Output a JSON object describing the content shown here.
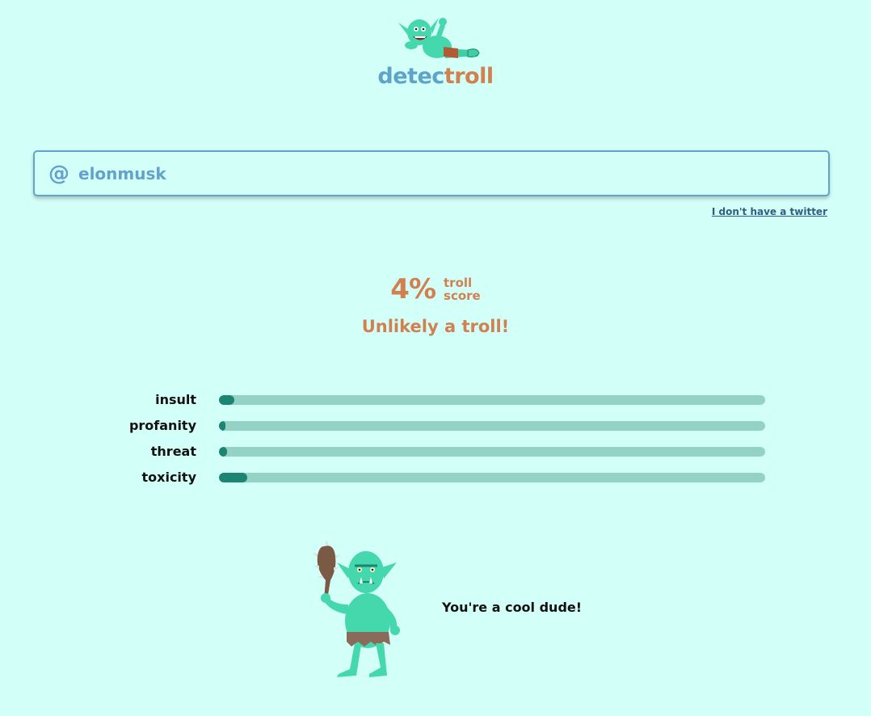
{
  "brand": {
    "part1": "detec",
    "part2": "troll",
    "colors": {
      "part1": "#5ea3c9",
      "part2": "#d1804f"
    },
    "mascot_icon": "lounging-troll-icon"
  },
  "search": {
    "prefix": "@",
    "value": "elonmusk"
  },
  "no_twitter_link": "I don't have a twitter",
  "score": {
    "percent_text": "4%",
    "label_line1": "troll",
    "label_line2": "score",
    "verdict": "Unlikely a troll!"
  },
  "metrics": [
    {
      "label": "insult",
      "value": 0.028
    },
    {
      "label": "profanity",
      "value": 0.012
    },
    {
      "label": "threat",
      "value": 0.015
    },
    {
      "label": "toxicity",
      "value": 0.052
    }
  ],
  "result": {
    "mascot_icon": "club-troll-icon",
    "message": "You're a cool dude!"
  },
  "colors": {
    "background": "#d3fff9",
    "accent_blue": "#63a3c7",
    "accent_orange": "#d1804f",
    "bar_track": "#93d3c6",
    "bar_fill": "#1b8571"
  }
}
